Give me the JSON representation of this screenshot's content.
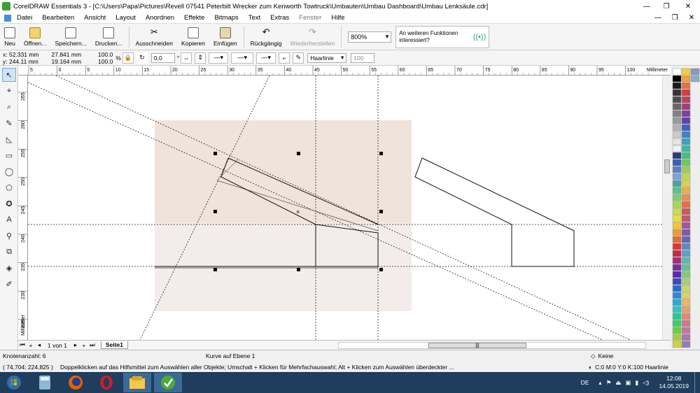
{
  "window": {
    "title": "CorelDRAW Essentials 3 - [C:\\Users\\Papa\\Pictures\\Revell 07541 Peterbilt Wrecker zum Kenworth Towtruck\\Umbauten\\Umbau Dashboard\\Umbau Lenksäule.cdr]",
    "min": "—",
    "max": "❐",
    "close": "✕"
  },
  "menu": {
    "items": [
      "Datei",
      "Bearbeiten",
      "Ansicht",
      "Layout",
      "Anordnen",
      "Effekte",
      "Bitmaps",
      "Text",
      "Extras",
      "Fenster",
      "Hilfe"
    ],
    "right": [
      "—",
      "❐",
      "✕"
    ]
  },
  "toolbar": {
    "new": "Neu",
    "open": "Öffnen...",
    "save": "Speichern...",
    "print": "Drucken...",
    "cut": "Ausschneiden",
    "copy": "Kopieren",
    "paste": "Einfügen",
    "undo": "Rückgängig",
    "redo": "Wiederherstellen",
    "zoom": "800%",
    "promo_line1": "An weiteren Funktionen",
    "promo_line2": "interessiert?"
  },
  "props": {
    "x": "x: 52.331 mm",
    "y": "y: 244.11 mm",
    "w": "27.841 mm",
    "h": "19.164 mm",
    "sx": "100.0",
    "sy": "100.0",
    "pct": "%",
    "angle": "0,0",
    "deg": "°",
    "outline": "Haarlinie",
    "num": "100"
  },
  "ruler": {
    "h_labels": [
      "5",
      "0",
      "5",
      "10",
      "15",
      "20",
      "25",
      "30",
      "35",
      "40",
      "45",
      "50",
      "55",
      "60",
      "65",
      "70",
      "75",
      "80",
      "85",
      "90",
      "95",
      "100"
    ],
    "unit": "Millimeter",
    "v_labels": [
      "265",
      "260",
      "255",
      "250",
      "245",
      "240",
      "235",
      "230",
      "225"
    ],
    "v_unit": "Millimeter"
  },
  "pagebar": {
    "pages": "1 von 1",
    "tab": "Seite1"
  },
  "status": {
    "nodes": "Knotenanzahl: 6",
    "curve": "Kurve auf Ebene 1",
    "coords": "( 74,704; 224,825 )",
    "hint": "Doppelklicken auf das Hilfsmittel zum Auswählen aller Objekte; Umschalt + Klicken für Mehrfachauswahl; Alt + Klicken zum Auswählen überdeckter ...",
    "fill": "Keine",
    "outline": "C:0 M:0 Y:0 K:100  Haarlinie"
  },
  "taskbar": {
    "lang": "DE",
    "time": "12:08",
    "date": "14.05.2019"
  },
  "colors": {
    "palette": [
      "#ffffff",
      "#000000",
      "#1a1a1a",
      "#333333",
      "#4d4d4d",
      "#666666",
      "#808080",
      "#999999",
      "#b3b3b3",
      "#cccccc",
      "#e6e6e6",
      "#f2f2f2",
      "#2b3a7a",
      "#3a5fb0",
      "#5a7ec8",
      "#7fa0d8",
      "#4aa3a0",
      "#5fbf8f",
      "#7fcf6f",
      "#a8d85a",
      "#c8e04a",
      "#e8e040",
      "#f0c830",
      "#f09a30",
      "#e86a30",
      "#d83a30",
      "#c82848",
      "#a82a7a",
      "#7a2a9a",
      "#5a2ab0",
      "#3a4ac0",
      "#2a6ad0",
      "#2a8ad8",
      "#2aaad0",
      "#2ac8c0",
      "#2ac890",
      "#3ad060",
      "#6ad040",
      "#a0d040",
      "#d0d040",
      "#f0d040",
      "#f0a040",
      "#e87040",
      "#d04040",
      "#c04060",
      "#a04080",
      "#8040a0",
      "#6040b0",
      "#4060c0",
      "#4080c8",
      "#40a0c0",
      "#40b8a8",
      "#48c080",
      "#70c860",
      "#98d058",
      "#c0d850",
      "#e0d050",
      "#e8b050",
      "#e89050",
      "#e07050",
      "#d05858",
      "#c05878",
      "#a05898",
      "#8058a8",
      "#6068b8",
      "#6088c0",
      "#60a0c0",
      "#60b8b0",
      "#68c098",
      "#88c880",
      "#a8d078",
      "#c8d870",
      "#e0d068",
      "#e8b868",
      "#e8a070",
      "#e08878",
      "#d07888",
      "#c078a0",
      "#a878b0",
      "#9080b8",
      "#8898c0",
      "#88b0c0"
    ]
  }
}
